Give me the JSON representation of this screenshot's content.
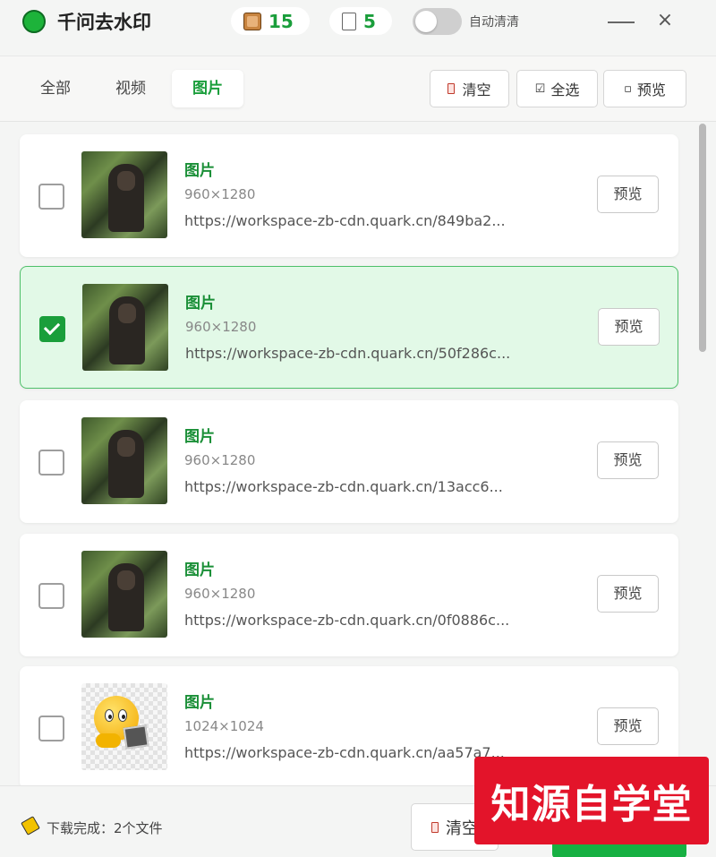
{
  "app": {
    "title": "千问去水印",
    "image_count": "15",
    "video_count": "5",
    "auto_clear_label": "自动清清",
    "auto_clear_on": false
  },
  "tabs": [
    {
      "label": "全部",
      "active": false
    },
    {
      "label": "视频",
      "active": false
    },
    {
      "label": "图片",
      "active": true
    }
  ],
  "toolbar": {
    "clear_label": "清空",
    "select_all_label": "全选",
    "preview_label": "预览"
  },
  "items": [
    {
      "title": "图片",
      "size": "960×1280",
      "url": "https://workspace-zb-cdn.quark.cn/849ba2...",
      "preview": "预览",
      "checked": false,
      "thumb": "gorilla"
    },
    {
      "title": "图片",
      "size": "960×1280",
      "url": "https://workspace-zb-cdn.quark.cn/50f286c...",
      "preview": "预览",
      "checked": true,
      "thumb": "gorilla"
    },
    {
      "title": "图片",
      "size": "960×1280",
      "url": "https://workspace-zb-cdn.quark.cn/13acc6...",
      "preview": "预览",
      "checked": false,
      "thumb": "gorilla"
    },
    {
      "title": "图片",
      "size": "960×1280",
      "url": "https://workspace-zb-cdn.quark.cn/0f0886c...",
      "preview": "预览",
      "checked": false,
      "thumb": "gorilla"
    },
    {
      "title": "图片",
      "size": "1024×1024",
      "url": "https://workspace-zb-cdn.quark.cn/aa57a7...",
      "preview": "预览",
      "checked": false,
      "thumb": "emoji"
    }
  ],
  "footer": {
    "status": "下载完成：2个文件",
    "clear_label": "清空"
  },
  "watermark": "知源自学堂",
  "colors": {
    "accent": "#1a9e3b",
    "selected_bg": "#e2f9e7",
    "watermark_red": "#e3142a"
  }
}
